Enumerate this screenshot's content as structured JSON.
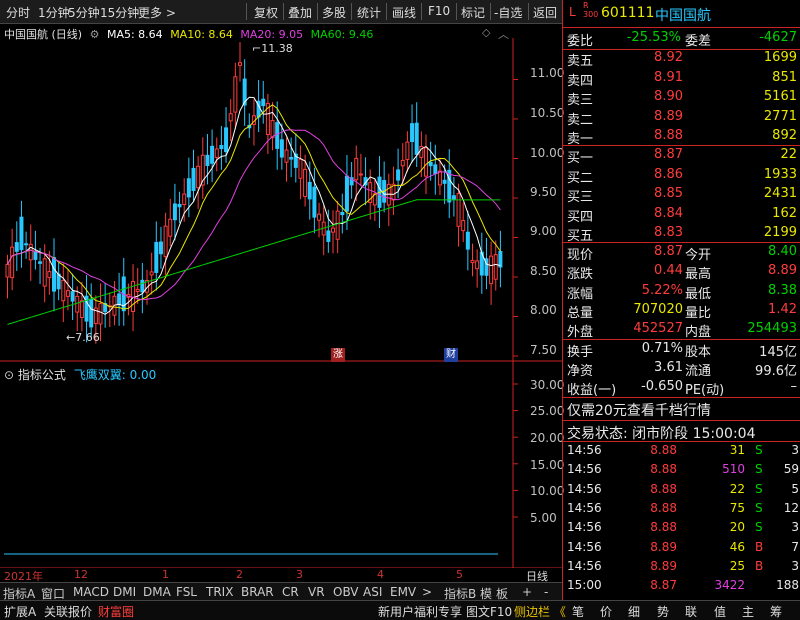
{
  "toolbar": {
    "items": [
      "分时",
      "1分钟",
      "5分钟",
      "15分钟",
      "更多 >",
      "复权",
      "叠加",
      "多股",
      "统计",
      "画线",
      "F10",
      "标记",
      "-自选",
      "返回"
    ]
  },
  "chart": {
    "stock_label": "中国国航 (日线)",
    "ma5": "MA5: 8.64",
    "ma10": "MA10: 8.64",
    "ma20": "MA20: 9.05",
    "ma60": "MA60: 9.46",
    "colors": {
      "ma5": "#ffffff",
      "ma10": "#e8e800",
      "ma20": "#e040e0",
      "ma60": "#00d000",
      "up": "#ff3c3c",
      "down": "#28c8ff"
    },
    "price_ticks": [
      "11.00",
      "10.50",
      "10.00",
      "9.50",
      "9.00",
      "8.50",
      "8.00",
      "7.50"
    ],
    "high_label": "11.38",
    "low_label": "7.66",
    "marker_zhang": "涨",
    "marker_cai": "财"
  },
  "indicator": {
    "title": "指标公式",
    "name": "飞鹰双翼: 0.00",
    "ticks": [
      "30.00",
      "25.00",
      "20.00",
      "15.00",
      "10.00",
      "5.00"
    ]
  },
  "time_axis": {
    "labels": [
      "2021年",
      "12",
      "1",
      "2",
      "3",
      "4",
      "5"
    ],
    "mode": "日线"
  },
  "tabs": [
    "指标A",
    "窗口",
    "MACD",
    "DMI",
    "DMA",
    "FSL",
    "TRIX",
    "BRAR",
    "CR",
    "VR",
    "OBV",
    "ASI",
    "EMV",
    ">",
    "指标B",
    "模",
    "板",
    "+",
    "-"
  ],
  "bottom": {
    "expand": "扩展A",
    "related": "关联报价",
    "wealth": "财富圈",
    "promo": "新用户福利专享",
    "f10": "图文F10",
    "sidebar": "侧边栏 《",
    "nav": [
      "笔",
      "价",
      "细",
      "势",
      "联",
      "值",
      "主",
      "筹"
    ]
  },
  "quote": {
    "lr": "L",
    "r300": "R\n300",
    "code": "601111",
    "name": "中国国航",
    "weibi_label": "委比",
    "weibi": "-25.53%",
    "weicha_label": "委差",
    "weicha": "-4627",
    "asks": [
      {
        "label": "卖五",
        "price": "8.92",
        "vol": "1699"
      },
      {
        "label": "卖四",
        "price": "8.91",
        "vol": "851"
      },
      {
        "label": "卖三",
        "price": "8.90",
        "vol": "5161"
      },
      {
        "label": "卖二",
        "price": "8.89",
        "vol": "2771"
      },
      {
        "label": "卖一",
        "price": "8.88",
        "vol": "892"
      }
    ],
    "bids": [
      {
        "label": "买一",
        "price": "8.87",
        "vol": "22"
      },
      {
        "label": "买二",
        "price": "8.86",
        "vol": "1933"
      },
      {
        "label": "买三",
        "price": "8.85",
        "vol": "2431"
      },
      {
        "label": "买四",
        "price": "8.84",
        "vol": "162"
      },
      {
        "label": "买五",
        "price": "8.83",
        "vol": "2199"
      }
    ],
    "stats": [
      {
        "l1": "现价",
        "v1": "8.87",
        "l2": "今开",
        "v2": "8.40"
      },
      {
        "l1": "涨跌",
        "v1": "0.44",
        "l2": "最高",
        "v2": "8.89"
      },
      {
        "l1": "涨幅",
        "v1": "5.22%",
        "l2": "最低",
        "v2": "8.38"
      },
      {
        "l1": "总量",
        "v1": "707020",
        "l2": "量比",
        "v2": "1.42"
      },
      {
        "l1": "外盘",
        "v1": "452527",
        "l2": "内盘",
        "v2": "254493"
      }
    ],
    "stats2": [
      {
        "l1": "换手",
        "v1": "0.71%",
        "l2": "股本",
        "v2": "145亿"
      },
      {
        "l1": "净资",
        "v1": "3.61",
        "l2": "流通",
        "v2": "99.6亿"
      },
      {
        "l1": "收益(一)",
        "v1": "-0.650",
        "l2": "PE(动)",
        "v2": "–"
      }
    ],
    "promo": "仅需20元查看千档行情",
    "status": "交易状态: 闭市阶段 15:00:04",
    "ticks": [
      {
        "t": "14:56",
        "p": "8.88",
        "v": "31",
        "bs": "S",
        "n": "3"
      },
      {
        "t": "14:56",
        "p": "8.88",
        "v": "510",
        "bs": "S",
        "n": "59"
      },
      {
        "t": "14:56",
        "p": "8.88",
        "v": "22",
        "bs": "S",
        "n": "5"
      },
      {
        "t": "14:56",
        "p": "8.88",
        "v": "75",
        "bs": "S",
        "n": "12"
      },
      {
        "t": "14:56",
        "p": "8.88",
        "v": "20",
        "bs": "S",
        "n": "3"
      },
      {
        "t": "14:56",
        "p": "8.89",
        "v": "46",
        "bs": "B",
        "n": "7"
      },
      {
        "t": "14:56",
        "p": "8.89",
        "v": "25",
        "bs": "B",
        "n": "3"
      },
      {
        "t": "15:00",
        "p": "8.87",
        "v": "3422",
        "bs": "",
        "n": "188"
      }
    ]
  }
}
